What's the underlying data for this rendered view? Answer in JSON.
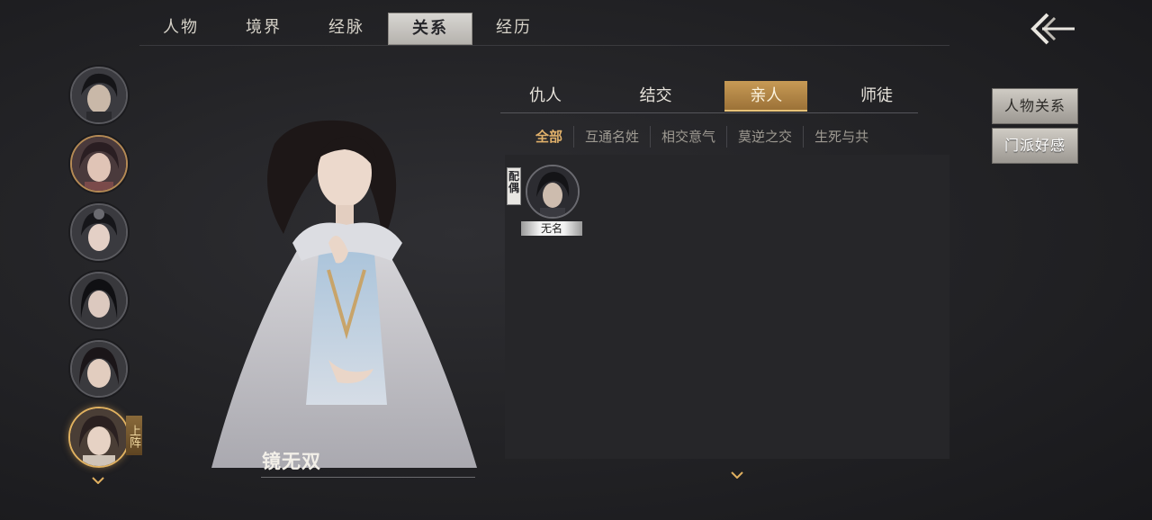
{
  "top_tabs": [
    "人物",
    "境界",
    "经脉",
    "关系",
    "经历"
  ],
  "top_tab_active": "关系",
  "relation_tabs": [
    "仇人",
    "结交",
    "亲人",
    "师徒"
  ],
  "relation_tab_active": "亲人",
  "sub_tabs": [
    "全部",
    "互通名姓",
    "相交意气",
    "莫逆之交",
    "生死与共"
  ],
  "sub_tab_active": "全部",
  "roster_deploy_label": "上阵",
  "character_name": "镜无双",
  "relations": [
    {
      "tag": "配偶",
      "name": "无名"
    }
  ],
  "side_buttons": [
    "人物关系",
    "门派好感"
  ],
  "colors": {
    "accent_gold": "#e0b060",
    "active_tab_bg": "#b98b4a",
    "panel_bg": "#262629"
  },
  "icons": [
    "back-arrow-icon",
    "chevron-down-icon"
  ]
}
